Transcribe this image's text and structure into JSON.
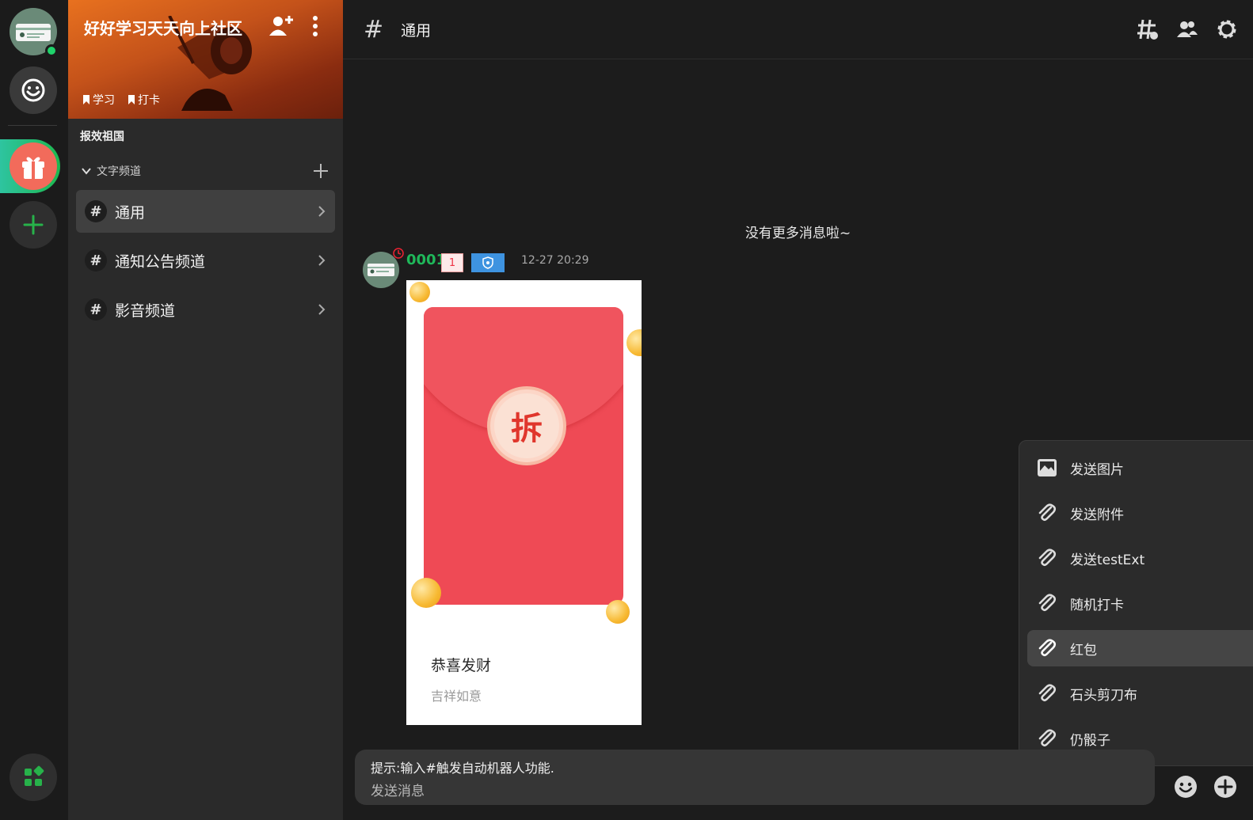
{
  "community": {
    "name": "好好学习天天向上社区",
    "tags": [
      "学习",
      "打卡"
    ],
    "section": "报效祖国",
    "group": "文字频道"
  },
  "channels": [
    {
      "label": "通用",
      "active": true
    },
    {
      "label": "通知公告频道",
      "active": false
    },
    {
      "label": "影音频道",
      "active": false
    }
  ],
  "header": {
    "hash": "#",
    "title": "通用"
  },
  "messages": {
    "no_more": "没有更多消息啦~",
    "item": {
      "username": "0001",
      "level": "1",
      "time": "12-27 20:29",
      "red_packet": {
        "seal": "拆",
        "title": "恭喜发财",
        "subtitle": "吉祥如意"
      }
    }
  },
  "menu": {
    "items": [
      {
        "label": "发送图片",
        "icon": "image-icon",
        "active": false
      },
      {
        "label": "发送附件",
        "icon": "paperclip-icon",
        "active": false
      },
      {
        "label": "发送testExt",
        "icon": "paperclip-icon",
        "active": false
      },
      {
        "label": "随机打卡",
        "icon": "paperclip-icon",
        "active": false
      },
      {
        "label": "红包",
        "icon": "paperclip-icon",
        "active": true
      },
      {
        "label": "石头剪刀布",
        "icon": "paperclip-icon",
        "active": false
      },
      {
        "label": "仍骰子",
        "icon": "paperclip-icon",
        "active": false
      }
    ]
  },
  "composer": {
    "hint": "提示:输入#触发自动机器人功能.",
    "placeholder": "发送消息"
  },
  "colors": {
    "accent_green": "#1fb85a",
    "banner_orange": "#e8711f",
    "red_packet": "#ef4a55"
  }
}
